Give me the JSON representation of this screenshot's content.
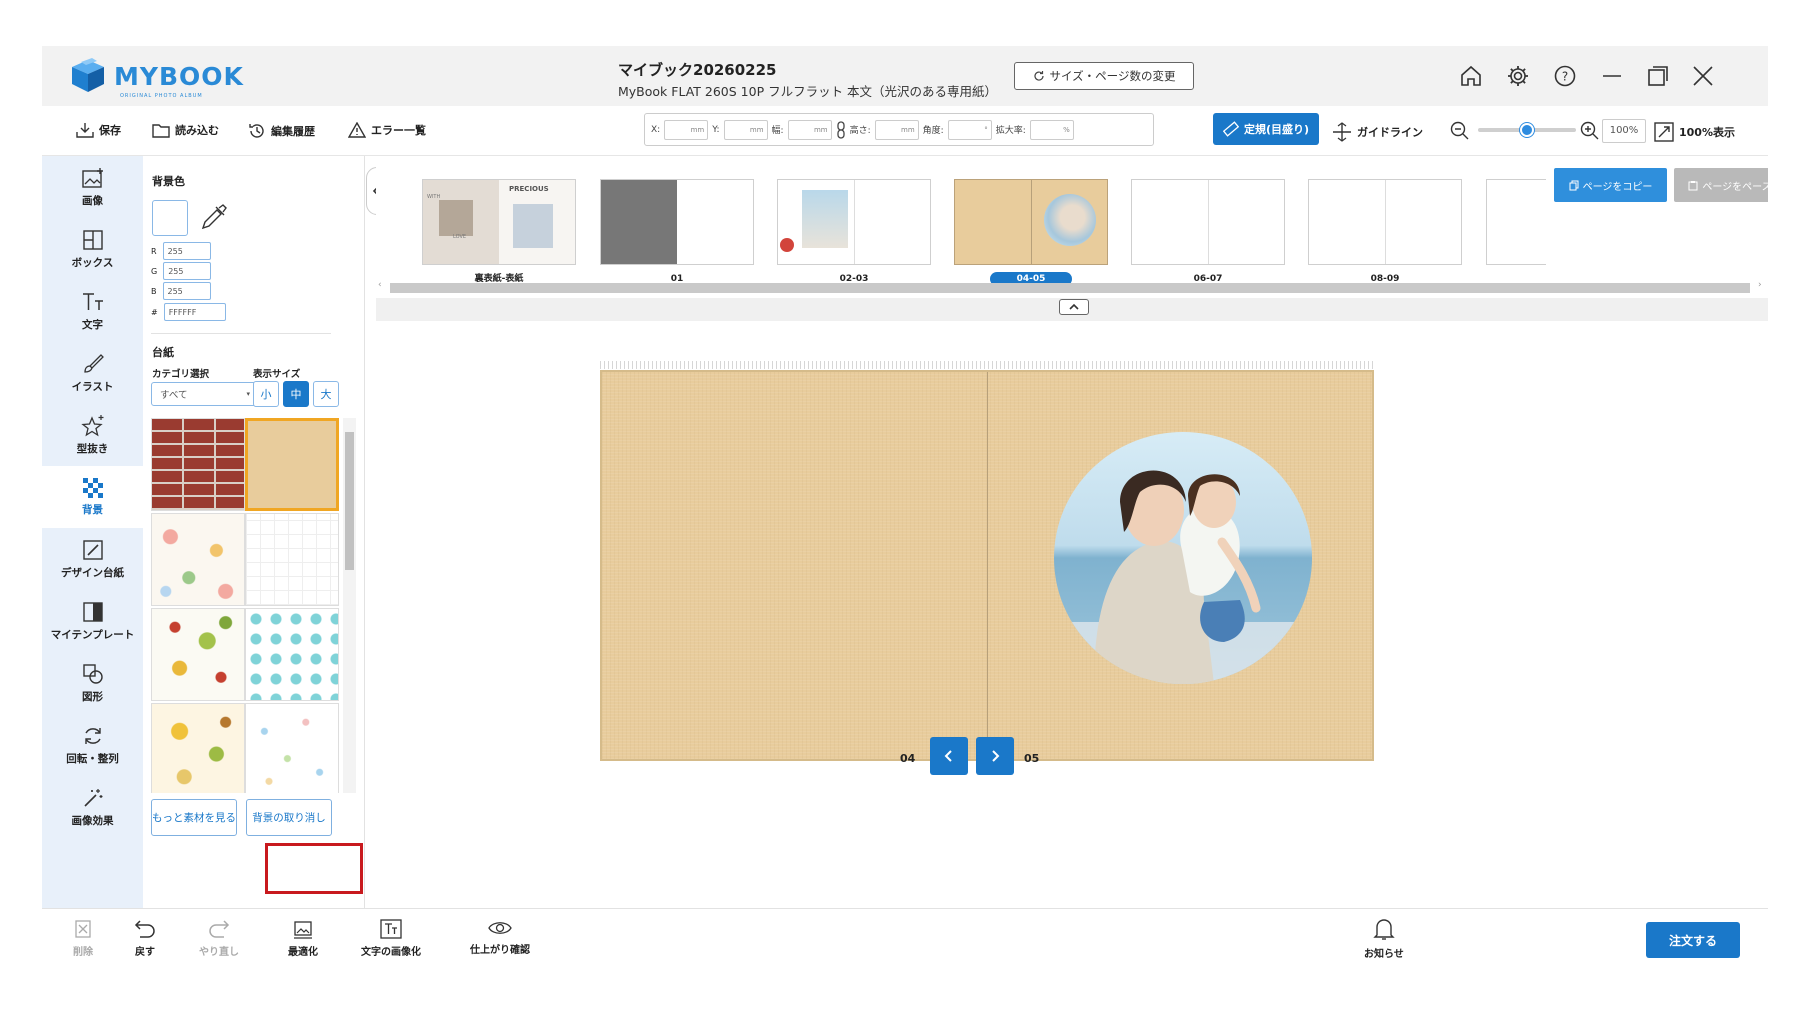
{
  "app": {
    "logo_text": "MYBOOK",
    "logo_sub": "ORIGINAL PHOTO ALBUM"
  },
  "header": {
    "title": "マイブック20260225",
    "subtitle": "MyBook FLAT 260S 10P フルフラット 本文（光沢のある専用紙）",
    "size_button": "サイズ・ページ数の変更",
    "icons": [
      "home-icon",
      "gear-icon",
      "help-icon",
      "minimize-icon",
      "restore-icon",
      "close-icon"
    ]
  },
  "toolbar": {
    "save": "保存",
    "load": "読み込む",
    "history": "編集履歴",
    "errors": "エラー一覧",
    "coords": [
      {
        "label": "X:",
        "unit": "mm"
      },
      {
        "label": "Y:",
        "unit": "mm"
      },
      {
        "label": "幅:",
        "unit": "mm"
      },
      {
        "label": "高さ:",
        "unit": "mm"
      },
      {
        "label": "角度:",
        "unit": "°"
      },
      {
        "label": "拡大率:",
        "unit": "%"
      }
    ],
    "ruler": "定規(目盛り)",
    "guideline": "ガイドライン",
    "zoom_value": "100%",
    "zoom_level": 0.5,
    "fit": "100%表示"
  },
  "rail": [
    {
      "label": "画像",
      "icon": "image-add-icon"
    },
    {
      "label": "ボックス",
      "icon": "box-icon"
    },
    {
      "label": "文字",
      "icon": "text-icon"
    },
    {
      "label": "イラスト",
      "icon": "brush-icon"
    },
    {
      "label": "型抜き",
      "icon": "star-cut-icon"
    },
    {
      "label": "背景",
      "icon": "background-icon",
      "active": true
    },
    {
      "label": "デザイン台紙",
      "icon": "design-mount-icon"
    },
    {
      "label": "マイテンプレート",
      "icon": "template-icon"
    },
    {
      "label": "図形",
      "icon": "shape-icon"
    },
    {
      "label": "回転・整列",
      "icon": "rotate-icon"
    },
    {
      "label": "画像効果",
      "icon": "magic-wand-icon"
    }
  ],
  "panel": {
    "bg_color_label": "背景色",
    "r_label": "R",
    "r": "255",
    "g_label": "G",
    "g": "255",
    "b_label": "B",
    "b": "255",
    "hex_label": "#",
    "hex": "FFFFFF",
    "mount_label": "台紙",
    "category_label": "カテゴリ選択",
    "category_value": "すべて",
    "size_label": "表示サイズ",
    "sizes": [
      "小",
      "中",
      "大"
    ],
    "more_button": "もっと素材を見る",
    "remove_button": "背景の取り消し"
  },
  "strip": {
    "thumbs": [
      {
        "label": "裏表紙-表紙",
        "active": false
      },
      {
        "label": "01",
        "active": false
      },
      {
        "label": "02-03",
        "active": false
      },
      {
        "label": "04-05",
        "active": true
      },
      {
        "label": "06-07",
        "active": false
      },
      {
        "label": "08-09",
        "active": false
      }
    ],
    "cover_text": "PRECIOUS",
    "cover_text2": "WITH",
    "cover_text3": "LOVE",
    "copy_button": "ページをコピー",
    "paste_button": "ページをペースト"
  },
  "canvas": {
    "left_page": "04",
    "right_page": "05"
  },
  "bottom": {
    "delete": "削除",
    "undo": "戻す",
    "redo": "やり直し",
    "optimize": "最適化",
    "text_image": "文字の画像化",
    "preview": "仕上がり確認",
    "notice": "お知らせ",
    "order": "注文する"
  },
  "colors": {
    "accent": "#1a78c9",
    "kraft": "#e8cc9c",
    "rail_bg": "#e8f0fa",
    "highlight": "#c8191e"
  }
}
